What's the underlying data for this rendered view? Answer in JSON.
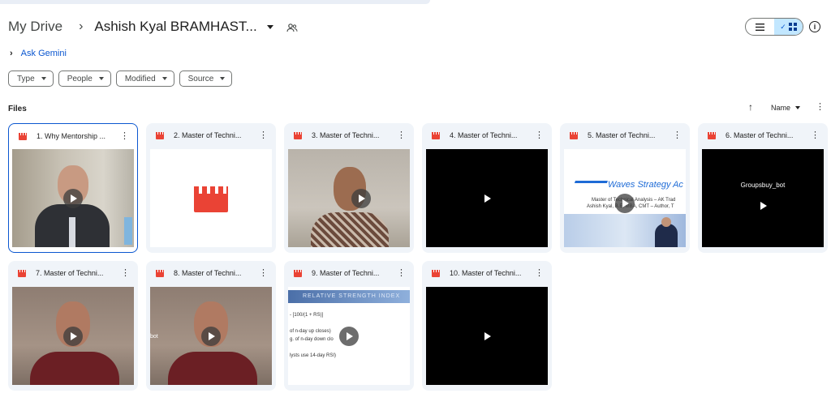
{
  "header": {
    "root": "My Drive",
    "separator": "›",
    "current_folder": "Ashish Kyal BRAMHAST...",
    "shared_icon": "people-icon"
  },
  "view": {
    "list_icon": "list-icon",
    "grid_icon": "grid-icon",
    "check": "✓",
    "active": "grid",
    "info_icon": "i"
  },
  "gemini": {
    "label": "Ask Gemini",
    "chevron": "›"
  },
  "filters": [
    {
      "label": "Type"
    },
    {
      "label": "People"
    },
    {
      "label": "Modified"
    },
    {
      "label": "Source"
    }
  ],
  "files_label": "Files",
  "sort": {
    "label": "Name",
    "direction_icon": "↑",
    "more": "⋮"
  },
  "files": [
    {
      "name": "1. Why Mentorship ...",
      "thumb": "person-office",
      "selected": true
    },
    {
      "name": "2. Master of Techni...",
      "thumb": "blank"
    },
    {
      "name": "3. Master of Techni...",
      "thumb": "person-shirt"
    },
    {
      "name": "4. Master of Techni...",
      "thumb": "black"
    },
    {
      "name": "5. Master of Techni...",
      "thumb": "slide",
      "slide_brand": "Waves Strategy Ac",
      "slide_line1": "Master of Technical Analysis – AK Trad",
      "slide_line2": "Ashish Kyal, B.E, MBA, CMT – Author, T"
    },
    {
      "name": "6. Master of Techni...",
      "thumb": "black-caption",
      "caption": "Groupsbuy_bot"
    },
    {
      "name": "7. Master of Techni...",
      "thumb": "person-red"
    },
    {
      "name": "8. Master of Techni...",
      "thumb": "person-red",
      "tag": "bot"
    },
    {
      "name": "9. Master of Techni...",
      "thumb": "rsi",
      "rsi_title": "RELATIVE STRENGTH INDEX",
      "rsi_lines": [
        "- [100/(1 + RS)]",
        "of n-day up closes)",
        "g. of n-day down clo",
        "lysts use 14-day RSI)"
      ]
    },
    {
      "name": "10. Master of Techni...",
      "thumb": "black"
    }
  ],
  "more_icon": "⋮"
}
